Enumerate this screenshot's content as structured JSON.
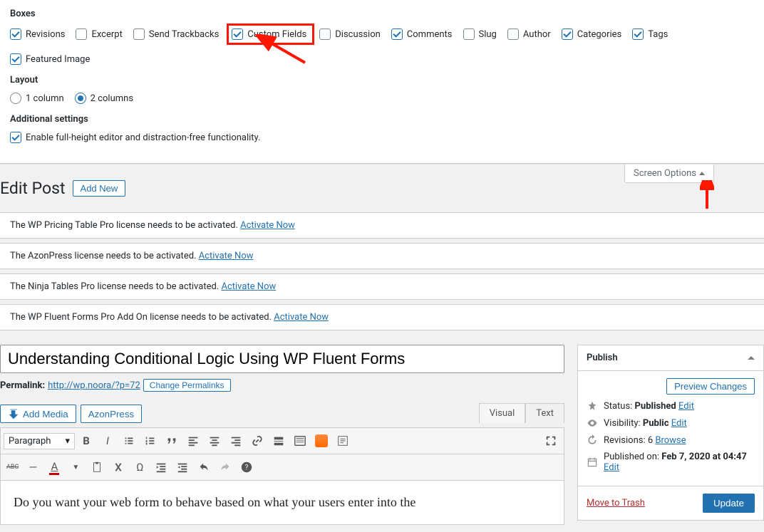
{
  "screenOptions": {
    "boxesHeading": "Boxes",
    "layoutHeading": "Layout",
    "additionalHeading": "Additional settings",
    "tabLabel": "Screen Options",
    "boxes": {
      "revisions": "Revisions",
      "excerpt": "Excerpt",
      "sendTrackbacks": "Send Trackbacks",
      "customFields": "Custom Fields",
      "discussion": "Discussion",
      "comments": "Comments",
      "slug": "Slug",
      "author": "Author",
      "categories": "Categories",
      "tags": "Tags",
      "featuredImage": "Featured Image"
    },
    "layoutOptions": {
      "col1": "1 column",
      "col2": "2 columns"
    },
    "fullHeight": "Enable full-height editor and distraction-free functionality."
  },
  "header": {
    "title": "Edit Post",
    "addNew": "Add New"
  },
  "notices": {
    "n1a": "The WP Pricing Table Pro license needs to be activated. ",
    "n2a": "The AzonPress license needs to be activated. ",
    "n3a": "The Ninja Tables Pro license needs to be activated. ",
    "n4a": "The WP Fluent Forms Pro Add On license needs to be activated. ",
    "activate": "Activate Now"
  },
  "post": {
    "title": "Understanding Conditional Logic Using WP Fluent Forms",
    "permalinkLabel": "Permalink:",
    "permalink": "http://wp.noora/?p=72",
    "changePermalinks": "Change Permalinks",
    "addMedia": "Add Media",
    "azonPress": "AzonPress",
    "visualTab": "Visual",
    "textTab": "Text",
    "formatSelector": "Paragraph",
    "abcLabel": "ABC",
    "body": "Do you want your web form to behave based on what your users enter into the"
  },
  "publish": {
    "heading": "Publish",
    "previewChanges": "Preview Changes",
    "statusLabel": "Status: ",
    "statusValue": "Published",
    "visibilityLabel": "Visibility: ",
    "visibilityValue": "Public",
    "revisionsLabel": "Revisions: ",
    "revisionsCount": "6",
    "browse": "Browse",
    "publishedLabel": "Published on: ",
    "publishedDate": "Feb 7, 2020 at 04:47",
    "edit": "Edit",
    "moveToTrash": "Move to Trash",
    "update": "Update"
  }
}
